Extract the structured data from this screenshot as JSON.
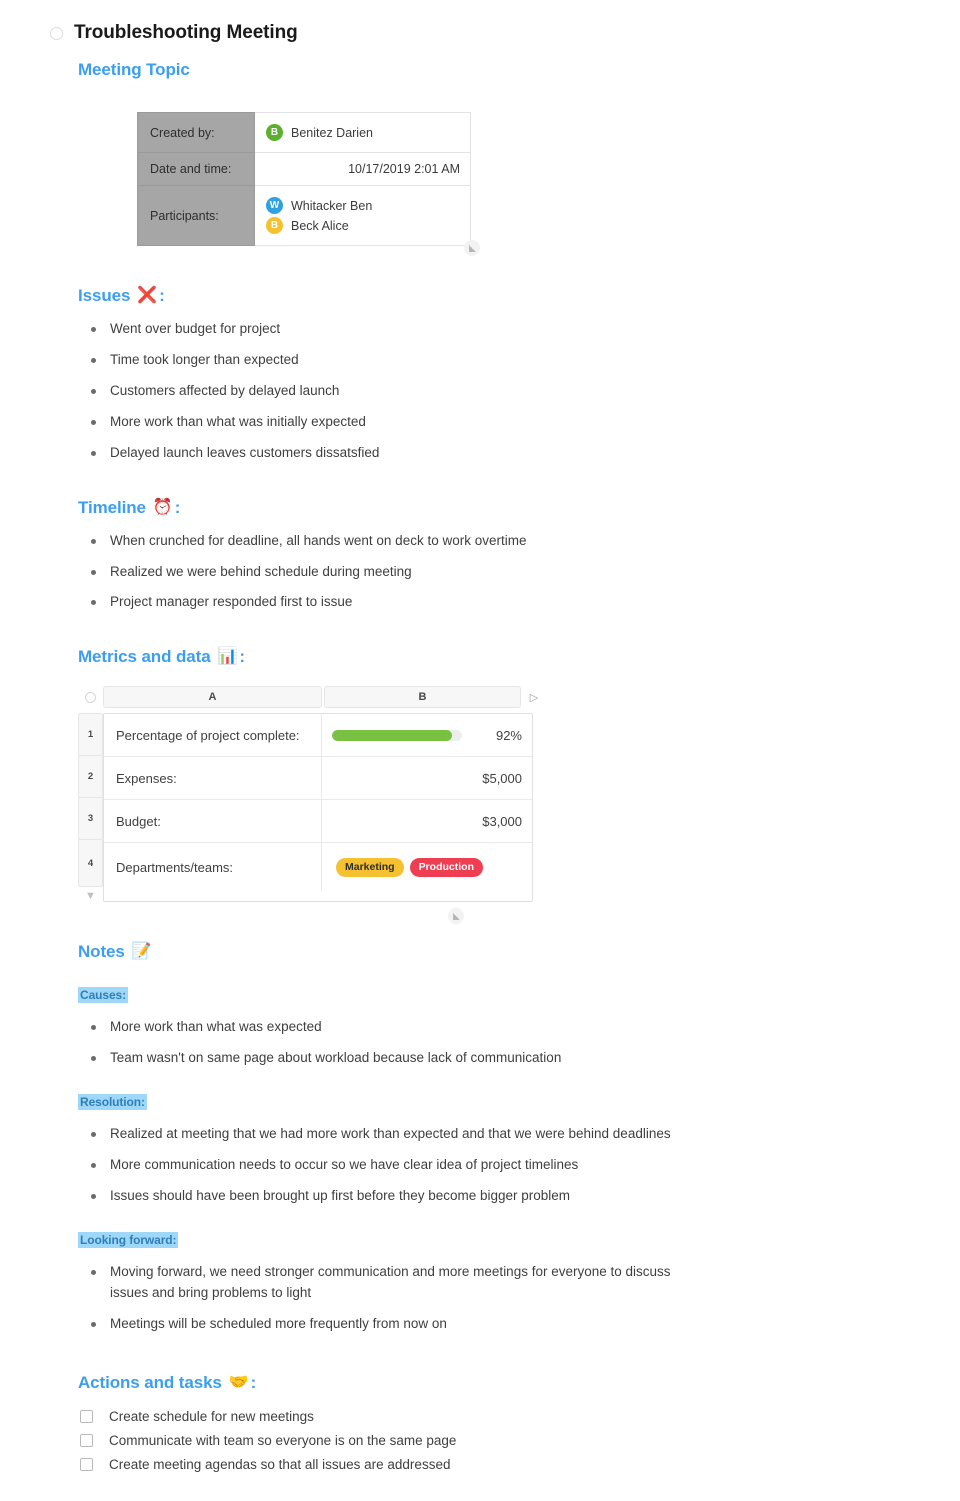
{
  "page": {
    "title": "Troubleshooting Meeting"
  },
  "colors": {
    "heading": "#3c9ef0",
    "highlight_bg": "#9ed7f7",
    "highlight_text": "#2f7fbb",
    "progress_fill": "#7ac143",
    "tag_marketing_bg": "#f5c131",
    "tag_production_bg": "#ef3e51",
    "label_cell_bg": "#a6a6a6",
    "avatar_green": "#5bb12f",
    "avatar_blue": "#33a1e0",
    "avatar_yellow": "#f5c131"
  },
  "sections": {
    "meeting_topic": {
      "heading": "Meeting Topic",
      "info_table": {
        "rows": [
          {
            "label": "Created by:",
            "type": "people"
          },
          {
            "label": "Date and time:",
            "type": "text"
          },
          {
            "label": "Participants:",
            "type": "people"
          }
        ],
        "created_by": [
          {
            "initial": "B",
            "name": "Benitez Darien",
            "color": "#5bb12f"
          }
        ],
        "date_and_time": "10/17/2019 2:01 AM",
        "participants": [
          {
            "initial": "W",
            "name": "Whitacker Ben",
            "color": "#33a1e0"
          },
          {
            "initial": "B",
            "name": "Beck Alice",
            "color": "#f5c131"
          }
        ]
      }
    },
    "issues": {
      "heading": "Issues",
      "emoji": "❌",
      "emoji_name": "cross-mark-icon",
      "colon": ":",
      "items": [
        "Went over budget for project",
        "Time took longer than expected",
        "Customers affected by delayed launch",
        "More work than what was initially expected",
        "Delayed launch leaves customers dissatsfied"
      ]
    },
    "timeline": {
      "heading": "Timeline",
      "emoji": "⏰",
      "emoji_name": "alarm-clock-icon",
      "colon": ":",
      "items": [
        "When crunched for deadline, all hands went on deck to work overtime",
        "Realized we were behind schedule during meeting",
        "Project manager responded first to issue"
      ]
    },
    "metrics": {
      "heading": "Metrics and data",
      "emoji": "📊",
      "emoji_name": "bar-chart-icon",
      "colon": ":"
    },
    "notes": {
      "heading": "Notes",
      "emoji": "📝",
      "emoji_name": "memo-icon",
      "colon": "",
      "groups": [
        {
          "label": "Causes:",
          "items": [
            "More work than what was expected",
            "Team wasn't on same page about workload because lack of communication"
          ]
        },
        {
          "label": "Resolution:",
          "items": [
            "Realized at meeting that we had more work than expected and that we were behind deadlines",
            "More communication needs to occur so we have clear idea of project timelines",
            "Issues should have been brought up first before they become bigger problem"
          ]
        },
        {
          "label": "Looking forward:",
          "items": [
            "Moving forward, we need stronger communication and more meetings for everyone to discuss issues and bring problems to light",
            "Meetings will be scheduled more frequently from now on"
          ]
        }
      ]
    },
    "actions": {
      "heading": "Actions and tasks",
      "emoji": "🤝",
      "emoji_name": "handshake-icon",
      "colon": ":",
      "tasks": [
        {
          "label": "Create schedule for new meetings",
          "checked": false
        },
        {
          "label": "Communicate with team so everyone is on the same page",
          "checked": false
        },
        {
          "label": "Create meeting agendas so that all issues are addressed",
          "checked": false
        }
      ]
    }
  },
  "chart_data": {
    "type": "table",
    "title": "Metrics and data",
    "columns": [
      "A",
      "B"
    ],
    "row_labels": [
      "1",
      "2",
      "3",
      "4"
    ],
    "rows": [
      {
        "label": "Percentage of project complete:",
        "value": "92%",
        "value_kind": "progress",
        "percent": 92
      },
      {
        "label": "Expenses:",
        "value": "$5,000",
        "value_kind": "currency"
      },
      {
        "label": "Budget:",
        "value": "$3,000",
        "value_kind": "currency"
      },
      {
        "label": "Departments/teams:",
        "value_kind": "tags",
        "tags": [
          {
            "text": "Marketing",
            "bg": "#f5c131",
            "fg": "#2e2e2e"
          },
          {
            "text": "Production",
            "bg": "#ef3e51",
            "fg": "#ffffff"
          }
        ]
      }
    ]
  }
}
